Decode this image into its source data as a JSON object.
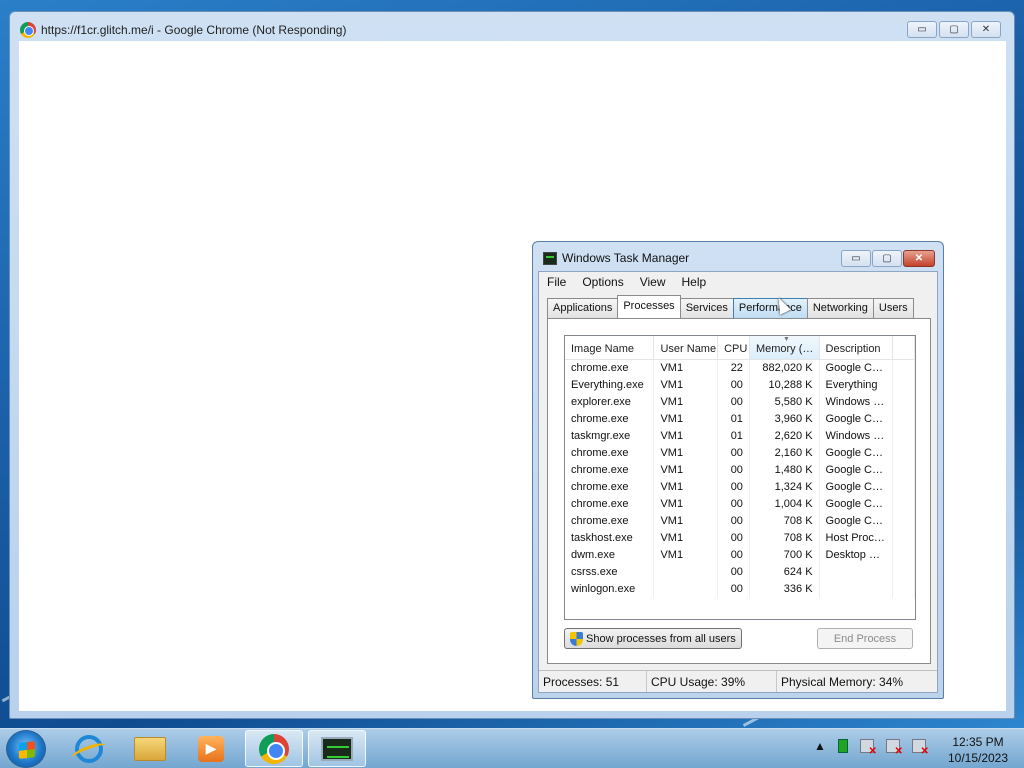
{
  "chrome": {
    "title": "https://f1cr.glitch.me/i - Google Chrome (Not Responding)",
    "buttons": {
      "minimize": "▭",
      "maximize": "▢",
      "close": "✕"
    }
  },
  "taskmgr": {
    "title": "Windows Task Manager",
    "buttons": {
      "minimize": "▭",
      "maximize": "▢",
      "close": "✕"
    },
    "menu": [
      "File",
      "Options",
      "View",
      "Help"
    ],
    "tabs": [
      "Applications",
      "Processes",
      "Services",
      "Performance",
      "Networking",
      "Users"
    ],
    "active_tab": "Processes",
    "columns": [
      "Image Name",
      "User Name",
      "CPU",
      "Memory (…",
      "Description"
    ],
    "rows": [
      [
        "chrome.exe",
        "VM1",
        "22",
        "882,020 K",
        "Google C…"
      ],
      [
        "Everything.exe",
        "VM1",
        "00",
        "10,288 K",
        "Everything"
      ],
      [
        "explorer.exe",
        "VM1",
        "00",
        "5,580 K",
        "Windows …"
      ],
      [
        "chrome.exe",
        "VM1",
        "01",
        "3,960 K",
        "Google C…"
      ],
      [
        "taskmgr.exe",
        "VM1",
        "01",
        "2,620 K",
        "Windows …"
      ],
      [
        "chrome.exe",
        "VM1",
        "00",
        "2,160 K",
        "Google C…"
      ],
      [
        "chrome.exe",
        "VM1",
        "00",
        "1,480 K",
        "Google C…"
      ],
      [
        "chrome.exe",
        "VM1",
        "00",
        "1,324 K",
        "Google C…"
      ],
      [
        "chrome.exe",
        "VM1",
        "00",
        "1,004 K",
        "Google C…"
      ],
      [
        "chrome.exe",
        "VM1",
        "00",
        "708 K",
        "Google C…"
      ],
      [
        "taskhost.exe",
        "VM1",
        "00",
        "708 K",
        "Host Proc…"
      ],
      [
        "dwm.exe",
        "VM1",
        "00",
        "700 K",
        "Desktop …"
      ],
      [
        "csrss.exe",
        "",
        "00",
        "624 K",
        ""
      ],
      [
        "winlogon.exe",
        "",
        "00",
        "336 K",
        ""
      ]
    ],
    "show_all_button": "Show processes from all users",
    "end_process_button": "End Process",
    "status": {
      "processes": "Processes: 51",
      "cpu": "CPU Usage: 39%",
      "memory": "Physical Memory: 34%"
    }
  },
  "taskbar": {
    "icons": [
      "start-orb",
      "internet-explorer-icon",
      "file-explorer-icon",
      "media-player-icon",
      "chrome-icon",
      "task-manager-icon"
    ],
    "tray_arrow": "▲",
    "clock_time": "12:35 PM",
    "clock_date": "10/15/2023"
  }
}
